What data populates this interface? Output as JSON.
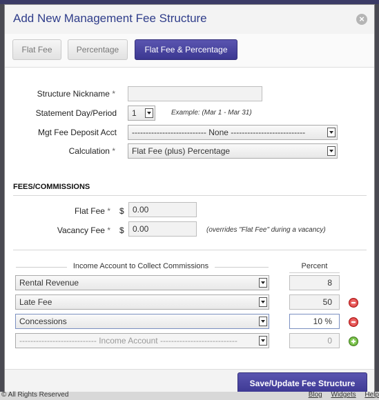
{
  "background": {
    "footer_left": "© All Rights Reserved",
    "footer_links": [
      "Blog",
      "Widgets",
      "Help"
    ]
  },
  "dialog": {
    "title": "Add New Management Fee Structure",
    "close_symbol": "×"
  },
  "tabs": [
    {
      "label": "Flat Fee",
      "active": false
    },
    {
      "label": "Percentage",
      "active": false
    },
    {
      "label": "Flat Fee & Percentage",
      "active": true
    }
  ],
  "form": {
    "nickname_label": "Structure Nickname",
    "nickname_value": "",
    "statement_label": "Statement Day/Period",
    "statement_value": "1",
    "statement_hint": "Example: (Mar 1 - Mar 31)",
    "deposit_label": "Mgt Fee Deposit Acct",
    "deposit_value": "--------------------------- None ---------------------------",
    "calculation_label": "Calculation",
    "calculation_value": "Flat Fee (plus) Percentage",
    "required_mark": "*"
  },
  "fees": {
    "section_title": "FEES/COMMISSIONS",
    "currency": "$",
    "flat_label": "Flat Fee",
    "flat_value": "0.00",
    "vacancy_label": "Vacancy Fee",
    "vacancy_value": "0.00",
    "vacancy_hint": "(overrides \"Flat Fee\" during a vacancy)"
  },
  "commissions": {
    "account_header": "Income Account to Collect Commissions",
    "percent_header": "Percent",
    "rows": [
      {
        "account": "Rental Revenue",
        "percent": "8",
        "action": "none"
      },
      {
        "account": "Late Fee",
        "percent": "50",
        "action": "remove"
      },
      {
        "account": "Concessions",
        "percent": "10 %",
        "action": "remove"
      },
      {
        "account": "---------------------------- Income Account ----------------------------",
        "percent": "0",
        "action": "add"
      }
    ]
  },
  "footer": {
    "save_label": "Save/Update Fee Structure"
  },
  "colors": {
    "accent": "#3b3791",
    "title": "#2f3d8a",
    "remove": "#d52b2b",
    "add": "#5aa82a"
  }
}
